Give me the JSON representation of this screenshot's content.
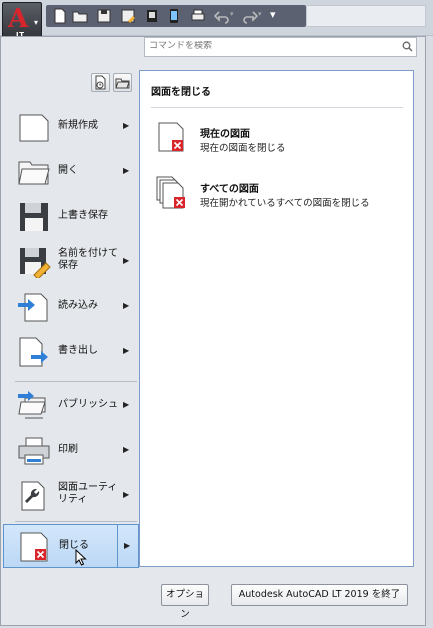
{
  "app_button": {
    "letter": "A",
    "sub": "LT"
  },
  "search": {
    "placeholder": "コマンドを検索"
  },
  "menu": {
    "items": [
      {
        "label": "新規作成",
        "has_arrow": true
      },
      {
        "label": "開く",
        "has_arrow": true
      },
      {
        "label": "上書き保存",
        "has_arrow": false
      },
      {
        "label": "名前を付けて保存",
        "has_arrow": true
      },
      {
        "label": "読み込み",
        "has_arrow": true
      },
      {
        "label": "書き出し",
        "has_arrow": true
      },
      {
        "label": "パブリッシュ",
        "has_arrow": true
      },
      {
        "label": "印刷",
        "has_arrow": true
      },
      {
        "label": "図面ユーティリティ",
        "has_arrow": true
      },
      {
        "label": "閉じる",
        "has_arrow": true,
        "selected": true
      }
    ]
  },
  "panel": {
    "title": "図面を閉じる",
    "entries": [
      {
        "title": "現在の図面",
        "desc": "現在の図面を閉じる"
      },
      {
        "title": "すべての図面",
        "desc": "現在開かれているすべての図面を閉じる"
      }
    ]
  },
  "buttons": {
    "options": "オプション",
    "exit": "Autodesk AutoCAD LT 2019 を終了"
  },
  "colors": {
    "accent": "#d9262c",
    "selection": "#bcd8f5",
    "toolbar": "#5b6170"
  }
}
